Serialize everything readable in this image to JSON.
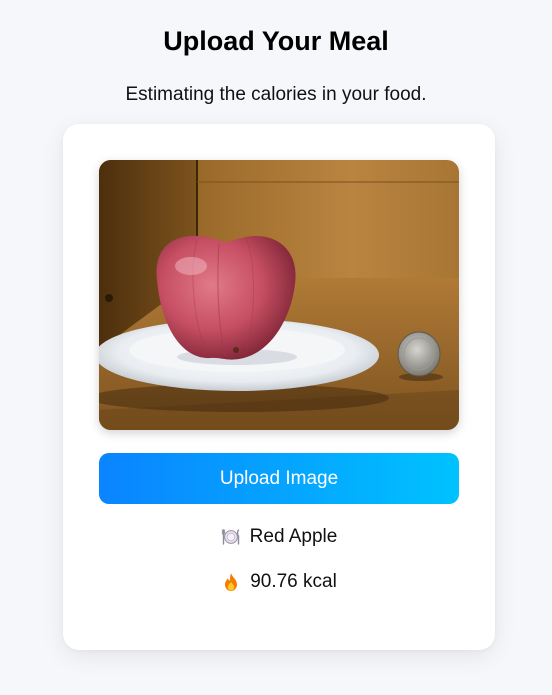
{
  "header": {
    "title": "Upload Your Meal",
    "subtitle": "Estimating the calories in your food."
  },
  "upload": {
    "button_label": "Upload Image"
  },
  "result": {
    "food_icon": "plate-with-cutlery-icon",
    "food_name": "Red Apple",
    "calorie_icon": "fire-icon",
    "calories": "90.76 kcal"
  },
  "colors": {
    "button_gradient_start": "#0a84ff",
    "button_gradient_end": "#00c2ff",
    "page_background": "#f5f7fa",
    "card_background": "#ffffff"
  }
}
